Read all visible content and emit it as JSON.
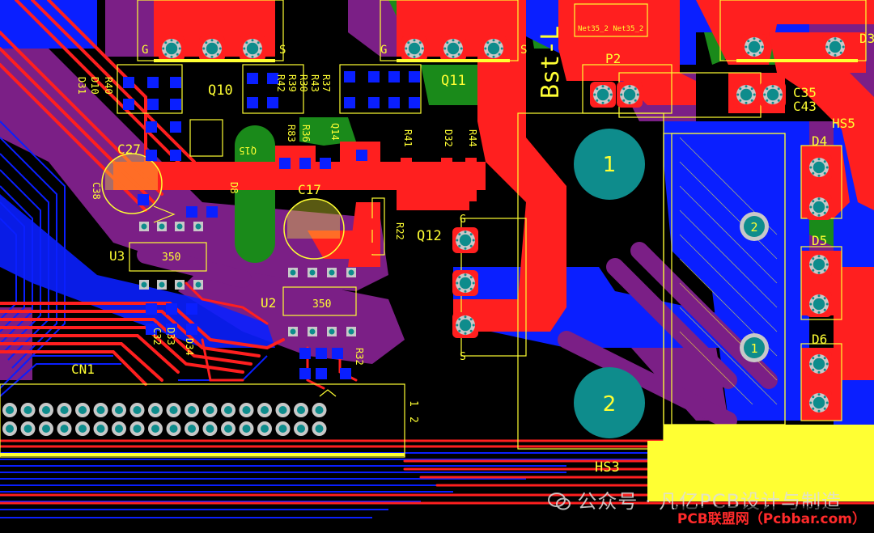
{
  "colors": {
    "background": "#000000",
    "top_copper": "#ff1f1f",
    "bottom_copper": "#0a1fff",
    "purple_pour": "#7b1f86",
    "green_pour": "#1a8a1a",
    "silkscreen": "#ffff33",
    "pad_teal": "#0e8c8c",
    "pad_ring": "#c8c8c8"
  },
  "designators": {
    "q10": "Q10",
    "q11": "Q11",
    "q12": "Q12",
    "q14": "Q14",
    "q15": "Q15",
    "p2": "P2",
    "c27": "C27",
    "c17": "C17",
    "c35": "C35",
    "c43": "C43",
    "c38": "C38",
    "hs3": "HS3",
    "hs5": "HS5",
    "u2": "U2",
    "u3": "U3",
    "cn1": "CN1",
    "d3": "D3",
    "d4": "D4",
    "d5": "D5",
    "d6": "D6",
    "r40": "R40",
    "d10": "D10",
    "d31": "D31",
    "r42": "R42",
    "r39": "R39",
    "r30": "R30",
    "r43": "R43",
    "r37": "R37",
    "r83": "R83",
    "r36": "R36",
    "r41": "R41",
    "d32": "D32",
    "r44": "R44",
    "d33": "D33",
    "d34": "D34",
    "c32": "C32",
    "r22": "R22",
    "r32": "R32",
    "d8": "D8"
  },
  "labels": {
    "gate_q10": "G",
    "source_q10": "S",
    "gate_q11": "G",
    "source_q11": "S",
    "gate_q12": "G",
    "source_q12": "S",
    "u3_value": "350",
    "u2_value": "350",
    "hs3_pad1": "1",
    "hs3_pad2": "2",
    "hs5_pad1": "1",
    "hs5_pad2": "2",
    "cn1_pin1": "1",
    "cn1_pin2": "2",
    "board_text": "Bst-L",
    "nets": "Net35_2  Net35_2"
  },
  "watermark": {
    "text": "公众号 · 凡亿PCB设计与制造",
    "credit": "PCB联盟网（Pcbbar.com）"
  }
}
